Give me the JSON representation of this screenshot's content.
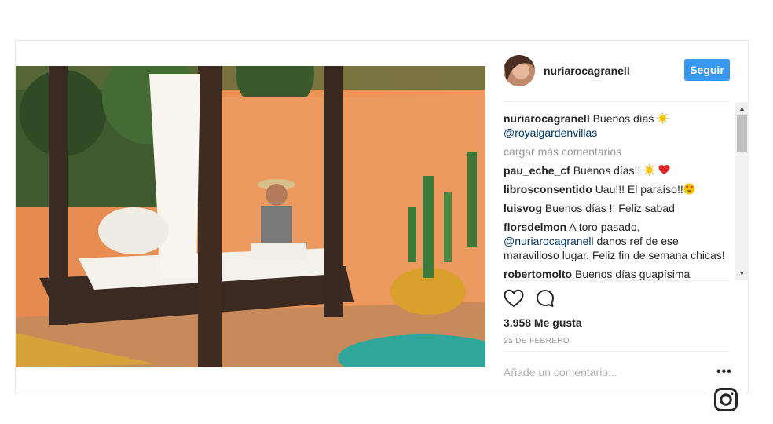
{
  "post": {
    "author": "nuriarocagranell",
    "follow_label": "Seguir",
    "caption_text": "Buenos días",
    "caption_mention": "@royalgardenvillas",
    "load_more": "cargar más comentarios",
    "comments": [
      {
        "user": "pau_eche_cf",
        "text": "Buenos días!!",
        "emojis": [
          "sun-emoji",
          "heart-emoji"
        ]
      },
      {
        "user": "librosconsentido",
        "text": "Uau!!! El paraíso!!",
        "emojis": [
          "heart-eyes-emoji"
        ]
      },
      {
        "user": "luisvog",
        "text": "Buenos días !! Feliz sabad"
      },
      {
        "user": "florsdelmon",
        "text": "A toro pasado,",
        "mention": "@nuriarocagranell",
        "text2": "danos ref de ese maravilloso lugar. Feliz fin de semana chicas!"
      },
      {
        "user": "robertomolto",
        "text": "Buenos días guapísima"
      }
    ],
    "likes": "3.958 Me gusta",
    "date": "25 DE FEBRERO",
    "comment_placeholder": "Añade un comentario...",
    "more_label": "•••"
  },
  "icons": [
    "heart-icon",
    "comment-icon",
    "instagram-icon",
    "more-options-icon"
  ],
  "colors": {
    "follow": "#3897f0",
    "mention": "#003569",
    "muted": "#999999"
  }
}
